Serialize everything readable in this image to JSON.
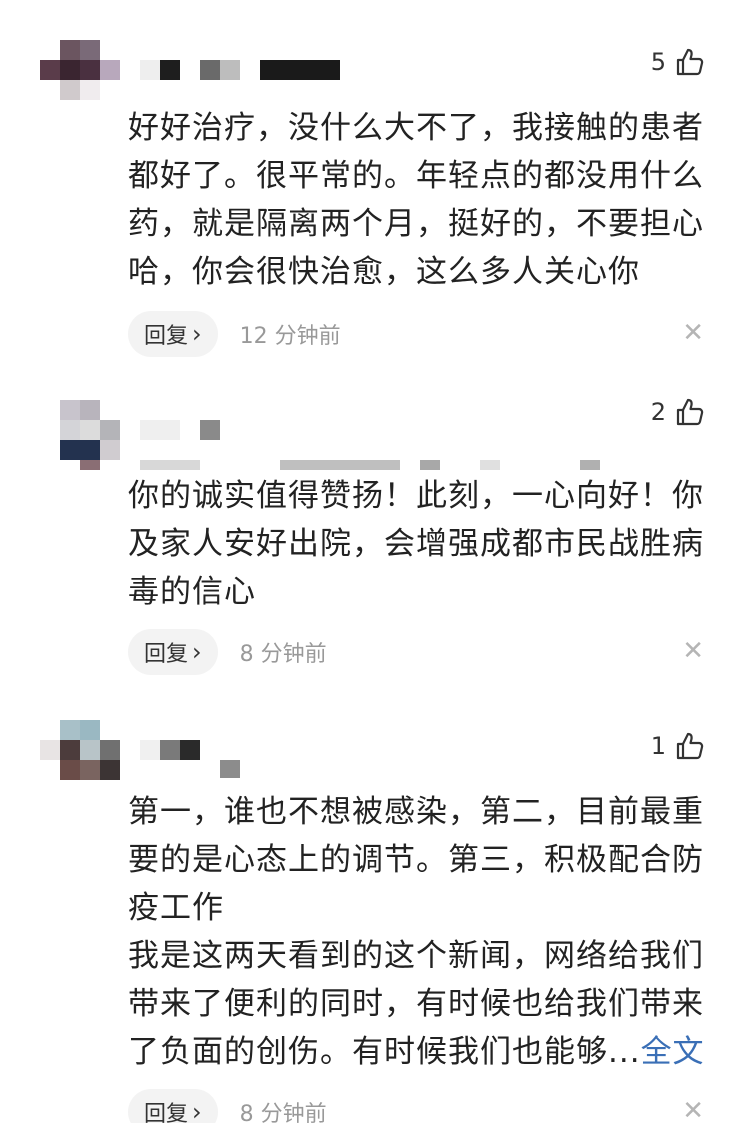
{
  "comments": [
    {
      "likes": "5",
      "text_lines": [
        "好好治疗，没什么大不了，我接触的患者都好了。很平常的。年轻点的都没用什么药，就是隔离两个月，挺好的，不要担心哈，你会很快治愈，这么多人关心你"
      ],
      "reply_label": "回复",
      "time": "12 分钟前"
    },
    {
      "likes": "2",
      "text_lines": [
        "你的诚实值得赞扬！此刻，一心向好！你及家人安好出院，会增强成都市民战胜病毒的信心"
      ],
      "reply_label": "回复",
      "time": "8 分钟前"
    },
    {
      "likes": "1",
      "text_lines": [
        "第一，谁也不想被感染，第二，目前最重要的是心态上的调节。第三，积极配合防疫工作",
        "我是这两天看到的这个新闻，网络给我们带来了便利的同时，有时候也给我们带来了负面的创伤。有时候我们也能够..."
      ],
      "more_link": "全文",
      "reply_label": "回复",
      "time": "8 分钟前"
    }
  ],
  "icons": {
    "like": "thumbs-up-icon",
    "reply_arrow": "chevron-right-icon",
    "dismiss": "close-icon"
  },
  "colors": {
    "link": "#3a6fb6",
    "reply_bg": "#f3f3f3",
    "meta_text": "#999999"
  }
}
